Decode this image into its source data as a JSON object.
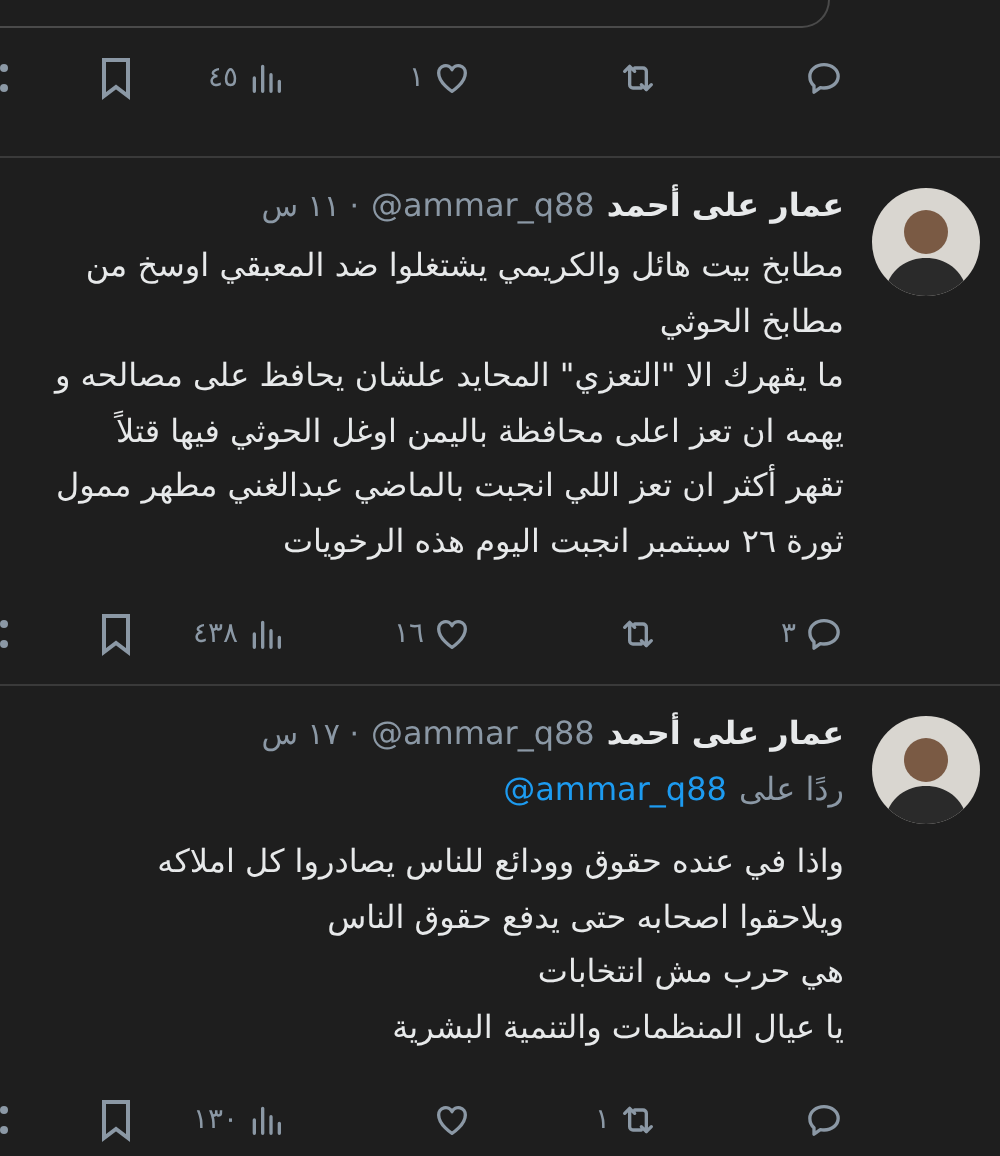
{
  "tweets": [
    {
      "kind": "tail",
      "actions": {
        "like": "١",
        "views": "٤٥"
      }
    },
    {
      "kind": "tweet",
      "name": "عمار على أحمد",
      "handle": "@ammar_q88",
      "time": "· ١١ س",
      "lines": [
        "مطابخ بيت هائل والكريمي يشتغلوا ضد المعبقي اوسخ من",
        "مطابخ الحوثي",
        "ما يقهرك الا \"التعزي\" المحايد  علشان يحافظ على مصالحه و",
        "يهمه ان تعز اعلى محافظة باليمن اوغل الحوثي فيها قتلاً",
        "تقهر أكثر ان تعز اللي انجبت بالماضي عبدالغني مطهر ممول",
        "ثورة ٢٦ سبتمبر  انجبت اليوم هذه الرخويات"
      ],
      "actions": {
        "reply": "٣",
        "like": "١٦",
        "views": "٤٣٨"
      }
    },
    {
      "kind": "tweet",
      "name": "عمار على أحمد",
      "handle": "@ammar_q88",
      "time": "· ١٧ س",
      "reply_to": {
        "label": "ردًا على",
        "handle": "@ammar_q88"
      },
      "lines": [
        "واذا في عنده حقوق وودائع للناس يصادروا كل املاكه",
        "ويلاحقوا اصحابه حتى يدفع حقوق الناس",
        "هي حرب مش انتخابات",
        "يا عيال المنظمات والتنمية البشرية"
      ],
      "actions": {
        "retweet": "١",
        "views": "١٣٠"
      }
    }
  ]
}
